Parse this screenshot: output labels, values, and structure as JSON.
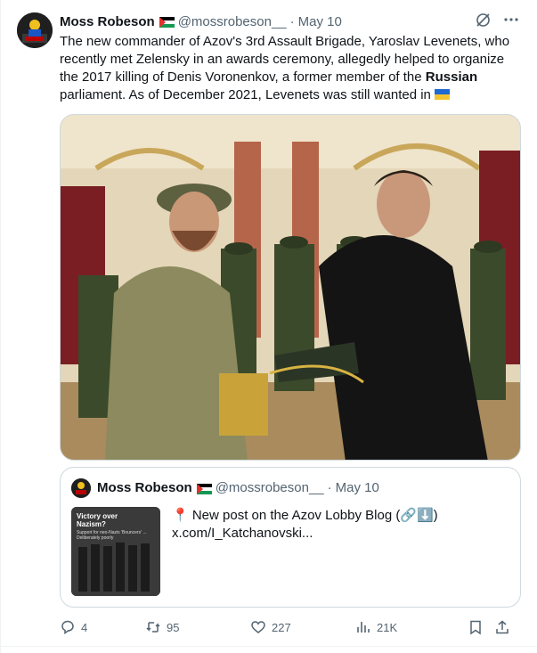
{
  "tweet": {
    "author_name": "Moss Robeson",
    "author_handle": "@mossrobeson__",
    "separator": "·",
    "date": "May 10",
    "body_parts": [
      "The new commander of Azov's 3rd Assault Brigade, Yaroslav Levenets, who recently met Zelensky in an awards ceremony, allegedly helped to organize the 2017 killing of Denis Voronenkov, a former member of the ",
      "Russian",
      " parliament. As of December 2021, Levenets was still wanted in "
    ],
    "flag_icon": "ukraine-flag-icon"
  },
  "quote": {
    "author_name": "Moss Robeson",
    "author_handle": "@mossrobeson__",
    "separator": "·",
    "date": "May 10",
    "line1": "📍 New post on the Azov Lobby Blog (🔗⬇️)",
    "line2": "x.com/I_Katchanovski...",
    "thumb_title": "Victory over Nazism?",
    "thumb_subtitle": "Support for neo-Nazis 'Bouncers' ... Deliberately poorly"
  },
  "actions": {
    "replies": "4",
    "reposts": "95",
    "likes": "227",
    "views": "21K"
  },
  "colors": {
    "text": "#0f1419",
    "secondary": "#536471",
    "border": "#cfd9de"
  }
}
